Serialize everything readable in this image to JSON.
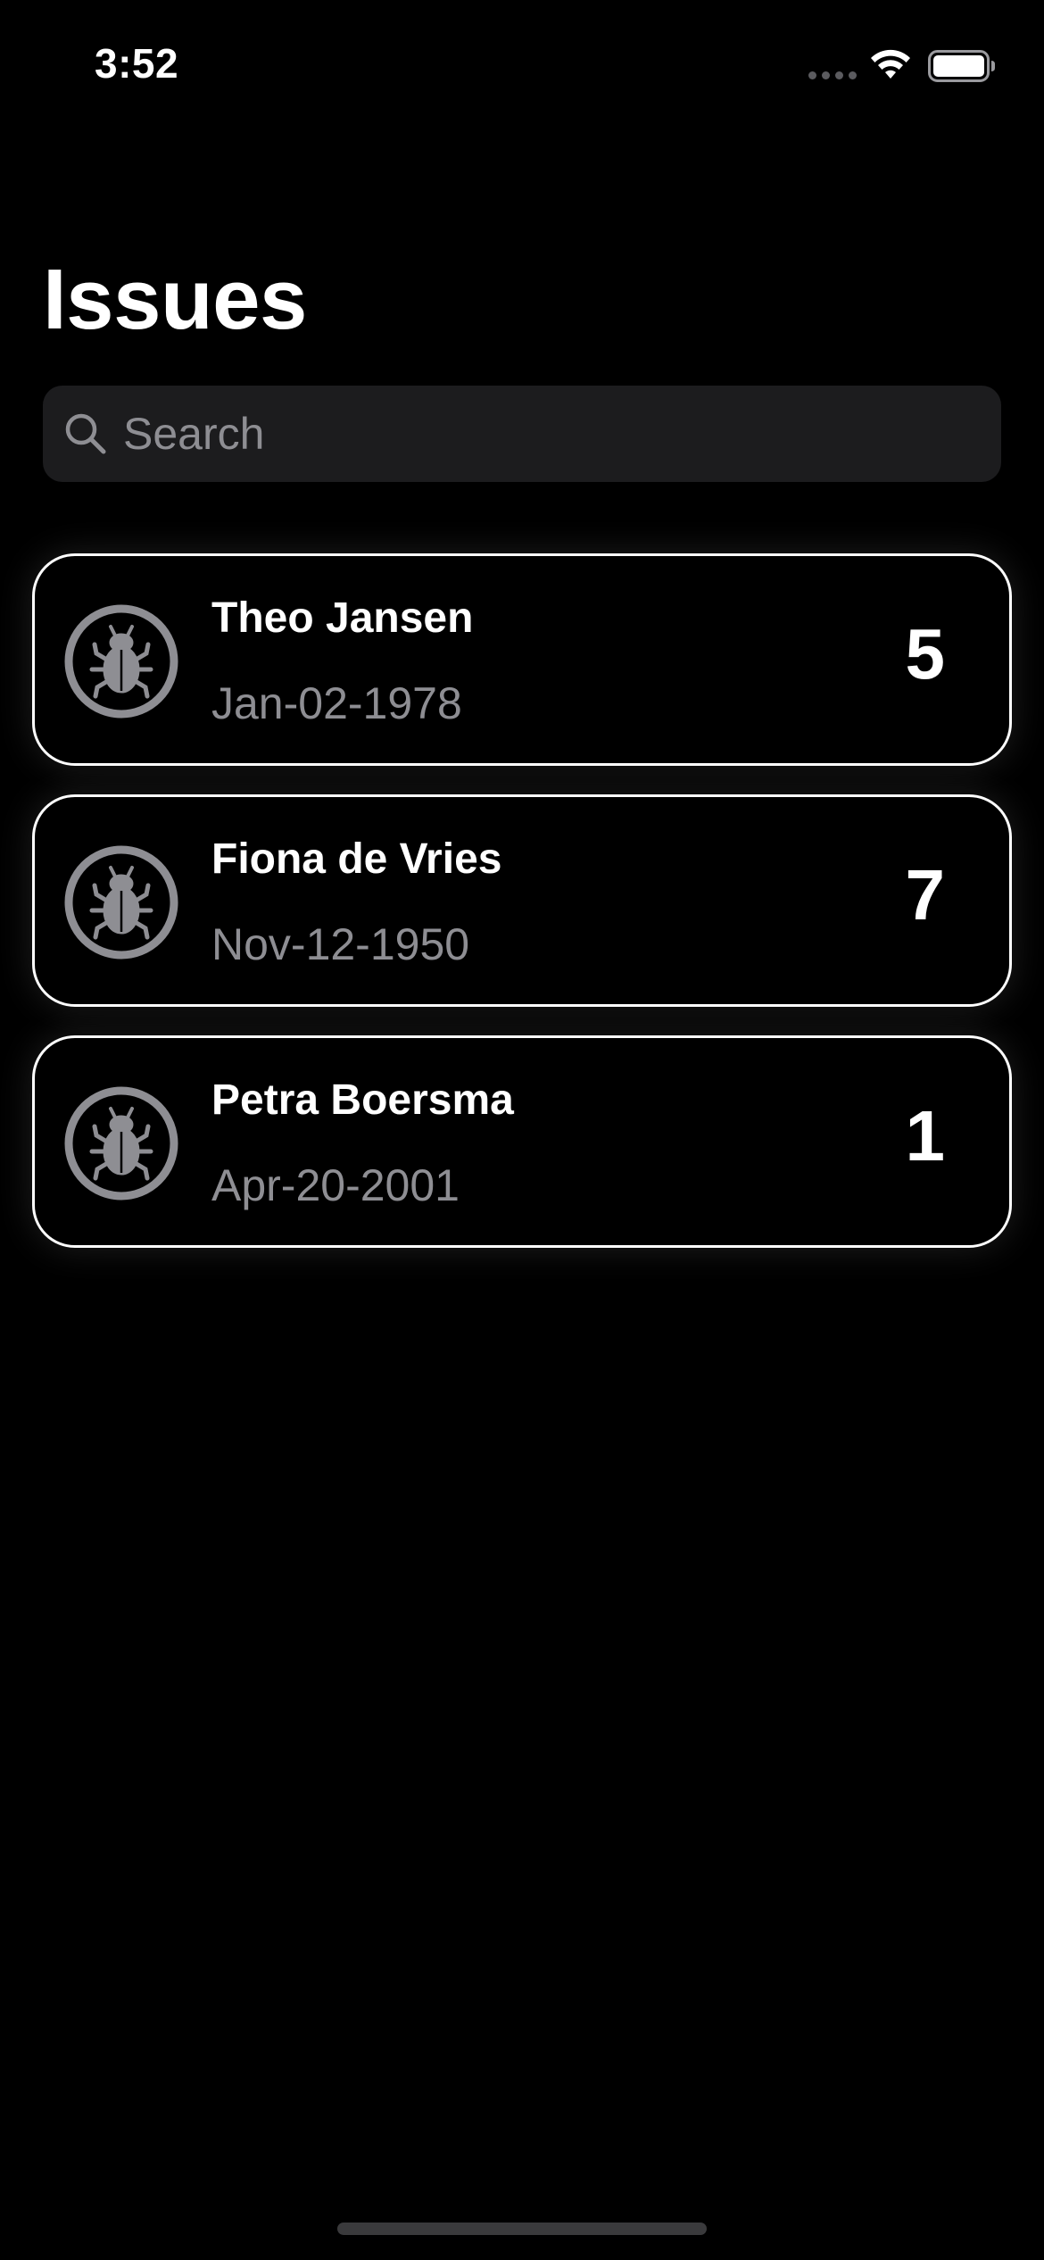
{
  "status_bar": {
    "time": "3:52"
  },
  "header": {
    "title": "Issues"
  },
  "search": {
    "placeholder": "Search",
    "value": ""
  },
  "issues": [
    {
      "name": "Theo Jansen",
      "date": "Jan-02-1978",
      "count": "5",
      "icon": "bug-icon"
    },
    {
      "name": "Fiona de Vries",
      "date": "Nov-12-1950",
      "count": "7",
      "icon": "bug-icon"
    },
    {
      "name": "Petra Boersma",
      "date": "Apr-20-2001",
      "count": "1",
      "icon": "bug-icon"
    }
  ],
  "colors": {
    "background": "#000000",
    "text_primary": "#ffffff",
    "text_secondary": "#8e8e93",
    "search_background": "#1c1c1e",
    "card_border": "#ffffff",
    "icon_gray": "#8e8e93"
  }
}
